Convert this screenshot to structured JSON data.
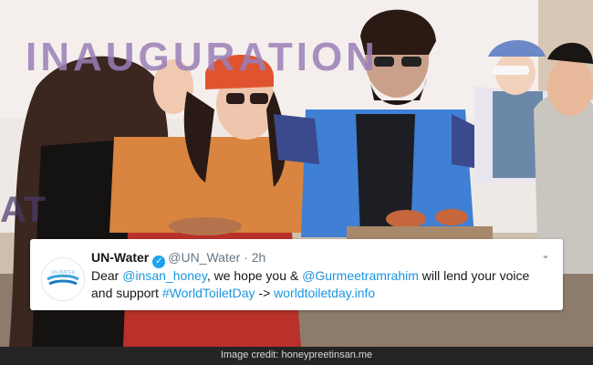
{
  "photo": {
    "banner_text_top": "INAUGURATION",
    "banner_text_left": "AT",
    "description_colors": {
      "background_wall": "#f1ece9",
      "banner_purple": "#9a7fb8",
      "orange_outfit": "#d9843f",
      "blue_vest": "#3f7fd4",
      "red_headband": "#e0532f"
    }
  },
  "tweet": {
    "name": "UN-Water",
    "handle": "@UN_Water",
    "separator": "·",
    "time": "2h",
    "caret_icon": "chevron-down-icon",
    "verified_icon": "verified-badge-icon",
    "text_parts": {
      "p1": "Dear ",
      "mention1": "@insan_honey",
      "p2": ", we hope you & ",
      "mention2": "@Gurmeetramrahim",
      "p3": " will lend your voice and support ",
      "hashtag": "#WorldToiletDay",
      "p4": " -> ",
      "link": "worldtoiletday.info"
    },
    "link_color": "#1b95e0"
  },
  "credit": {
    "text": "Image credit: honeypreetinsan.me"
  }
}
